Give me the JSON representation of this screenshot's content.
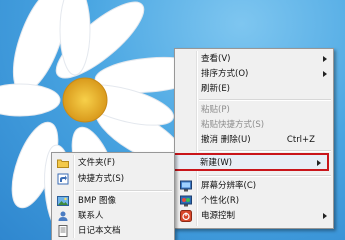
{
  "desktop_menu": {
    "items": [
      {
        "label": "查看(V)",
        "has_submenu": true,
        "enabled": true
      },
      {
        "label": "排序方式(O)",
        "has_submenu": true,
        "enabled": true
      },
      {
        "label": "刷新(E)",
        "has_submenu": false,
        "enabled": true
      },
      {
        "label": "粘贴(P)",
        "has_submenu": false,
        "enabled": false
      },
      {
        "label": "粘贴快捷方式(S)",
        "has_submenu": false,
        "enabled": false
      },
      {
        "label": "撤消 删除(U)",
        "shortcut": "Ctrl+Z",
        "has_submenu": false,
        "enabled": true
      },
      {
        "label": "新建(W)",
        "has_submenu": true,
        "enabled": true,
        "highlighted": true
      },
      {
        "label": "屏幕分辨率(C)",
        "icon": "screen-resolution-icon",
        "enabled": true
      },
      {
        "label": "个性化(R)",
        "icon": "personalize-icon",
        "enabled": true
      },
      {
        "label": "电源控制",
        "icon": "power-icon",
        "has_submenu": true,
        "enabled": true
      }
    ]
  },
  "new_submenu": {
    "items": [
      {
        "label": "文件夹(F)",
        "icon": "folder-icon"
      },
      {
        "label": "快捷方式(S)",
        "icon": "shortcut-icon"
      },
      {
        "label": "BMP 图像",
        "icon": "bmp-image-icon"
      },
      {
        "label": "联系人",
        "icon": "contact-icon"
      },
      {
        "label": "日记本文档",
        "icon": "journal-document-icon"
      }
    ]
  },
  "colors": {
    "highlight_border": "#c9151b",
    "menu_background": "#f0f0f0",
    "sky": "#4aa6e2"
  }
}
